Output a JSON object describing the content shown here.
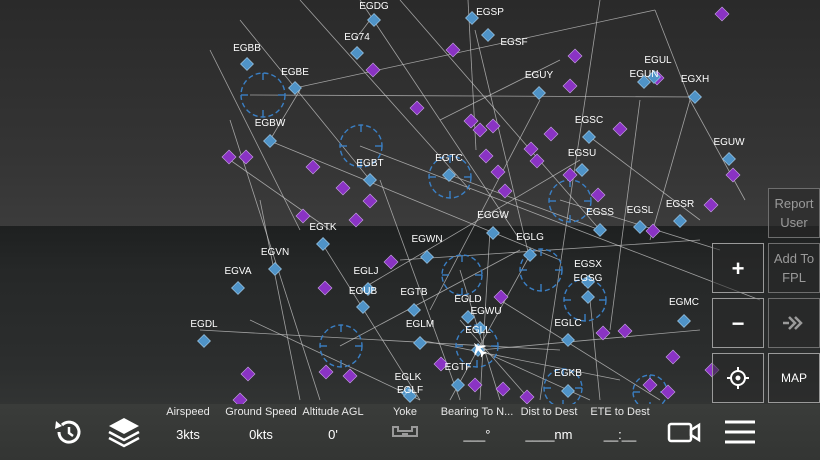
{
  "side_buttons": {
    "report_user": "Report User",
    "add_to_fpl": "Add To FPL",
    "zoom_in": "+",
    "zoom_out": "−",
    "map": "MAP"
  },
  "indicators": [
    {
      "label": "Airspeed",
      "value": "3kts"
    },
    {
      "label": "Ground Speed",
      "value": "0kts"
    },
    {
      "label": "Altitude AGL",
      "value": "0'"
    },
    {
      "label": "Yoke",
      "value": ""
    },
    {
      "label": "Bearing To N...",
      "value": "___°"
    },
    {
      "label": "Dist to Dest",
      "value": "____nm"
    },
    {
      "label": "ETE to Dest",
      "value": "__:__"
    }
  ],
  "icons": {
    "undo": "undo-icon",
    "layers": "layers-icon",
    "camera": "camera-icon",
    "menu": "hamburger-menu-icon",
    "locate": "crosshair-icon",
    "direct_to": "direct-to-icon",
    "yoke": "yoke-icon",
    "aircraft": "aircraft-icon"
  },
  "colors": {
    "airport": "#4f93c7",
    "navaid": "#8a33c4",
    "circle": "#3a7fc4",
    "route_line": "#c8c8c8"
  },
  "airports": [
    {
      "code": "EGDG"
    },
    {
      "code": "EGSP"
    },
    {
      "code": "EGBB"
    },
    {
      "code": "EG74"
    },
    {
      "code": "EGSF"
    },
    {
      "code": "EGBE"
    },
    {
      "code": "EGUL"
    },
    {
      "code": "EGUY"
    },
    {
      "code": "EGUN"
    },
    {
      "code": "EGXH"
    },
    {
      "code": "EGBW"
    },
    {
      "code": "EGSC"
    },
    {
      "code": "EGUW"
    },
    {
      "code": "EGBT"
    },
    {
      "code": "EGTC"
    },
    {
      "code": "EGSU"
    },
    {
      "code": "EGSS"
    },
    {
      "code": "EGSL"
    },
    {
      "code": "EGSR"
    },
    {
      "code": "EGGW"
    },
    {
      "code": "EGTK"
    },
    {
      "code": "EGWN"
    },
    {
      "code": "EGLG"
    },
    {
      "code": "EGVN"
    },
    {
      "code": "EGSX"
    },
    {
      "code": "EGVA"
    },
    {
      "code": "EGLJ"
    },
    {
      "code": "EGSG"
    },
    {
      "code": "EGUB"
    },
    {
      "code": "EGTB"
    },
    {
      "code": "EGLD"
    },
    {
      "code": "EGWU"
    },
    {
      "code": "EGMC"
    },
    {
      "code": "EGDL"
    },
    {
      "code": "EGLM"
    },
    {
      "code": "EGLC"
    },
    {
      "code": "EGLL"
    },
    {
      "code": "EGTF"
    },
    {
      "code": "EGKB"
    },
    {
      "code": "EGLK"
    },
    {
      "code": "EGLF"
    }
  ]
}
